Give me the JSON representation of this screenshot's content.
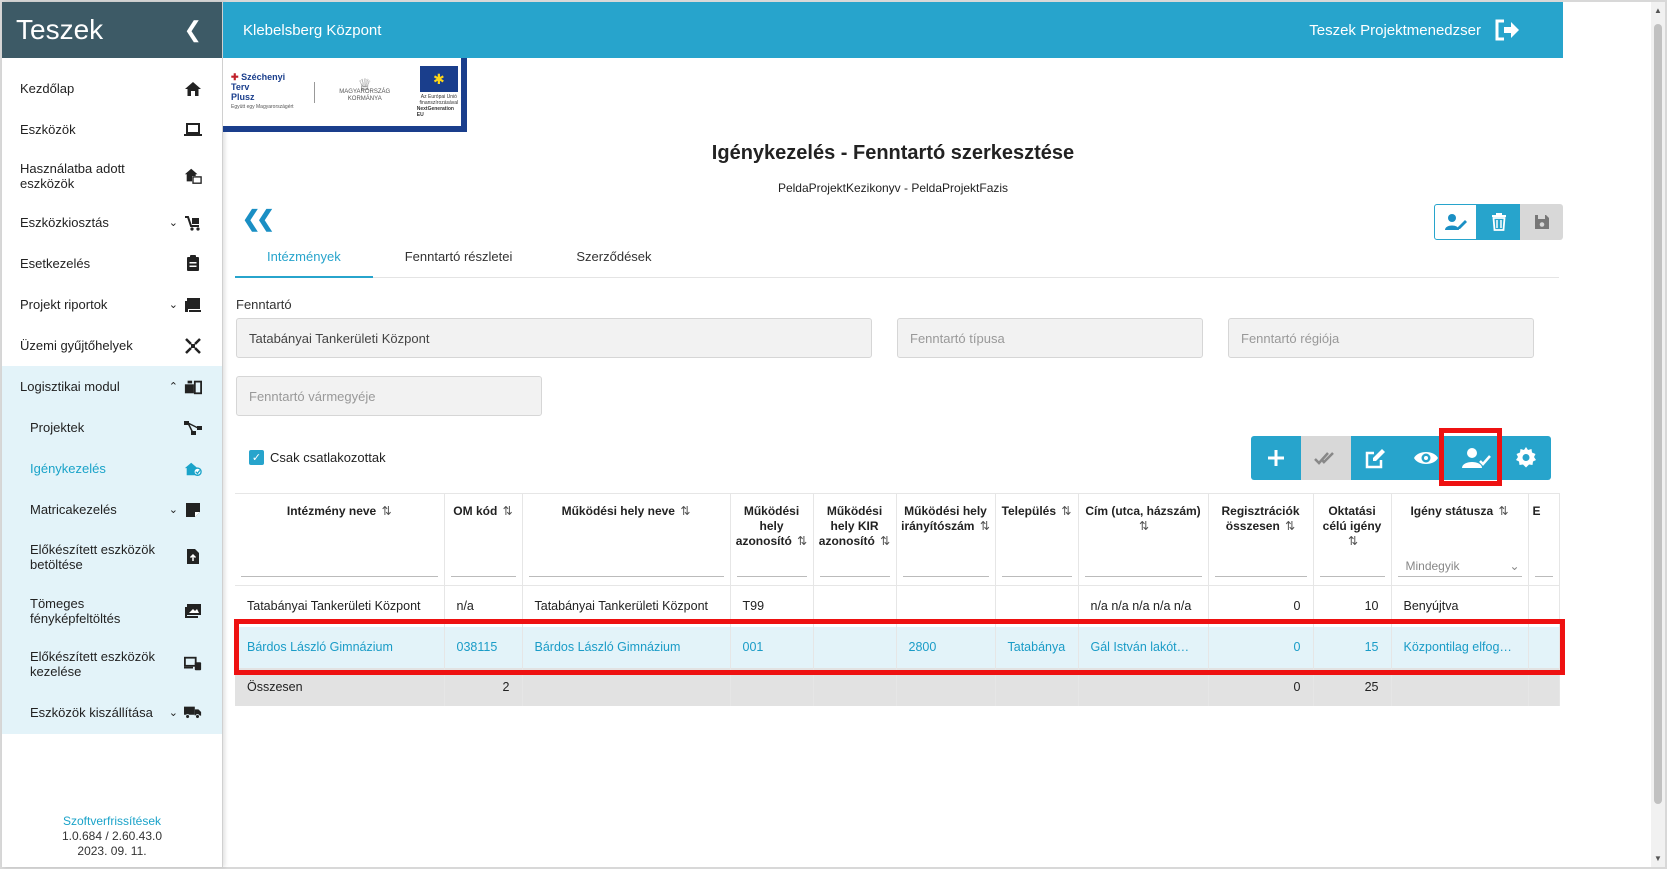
{
  "sidebar": {
    "title": "Teszek",
    "items": [
      {
        "label": "Kezdőlap"
      },
      {
        "label": "Eszközök"
      },
      {
        "label": "Használatba adott eszközök"
      },
      {
        "label": "Eszközkiosztás"
      },
      {
        "label": "Esetkezelés"
      },
      {
        "label": "Projekt riportok"
      },
      {
        "label": "Üzemi gyűjtőhelyek"
      },
      {
        "label": "Logisztikai modul"
      }
    ],
    "subitems": [
      {
        "label": "Projektek"
      },
      {
        "label": "Igénykezelés"
      },
      {
        "label": "Matricakezelés"
      },
      {
        "label": "Előkészített eszközök betöltése"
      },
      {
        "label": "Tömeges fényképfeltöltés"
      },
      {
        "label": "Előkészített eszközök kezelése"
      },
      {
        "label": "Eszközök kiszállítása"
      }
    ],
    "footer": {
      "updates_link": "Szoftverfrissítések",
      "version": "1.0.684 / 2.60.43.0",
      "date": "2023. 09. 11."
    }
  },
  "topbar": {
    "org": "Klebelsberg Központ",
    "user": "Teszek Projektmenedzser"
  },
  "banner": {
    "szechenyi_line1": "Széchenyi Terv",
    "szechenyi_line2": "Plusz",
    "szechenyi_small": "Együtt egy Magyarországért",
    "gov_text": "MAGYARORSZÁG KORMÁNYA",
    "eu_text1": "Az Európai Unió",
    "eu_text2": "finanszírozásával",
    "eu_text3": "NextGeneration EU"
  },
  "page": {
    "title": "Igénykezelés - Fenntartó szerkesztése",
    "subtitle": "PeldaProjektKezikonyv - PeldaProjektFazis"
  },
  "tabs": [
    {
      "label": "Intézmények",
      "active": true
    },
    {
      "label": "Fenntartó részletei",
      "active": false
    },
    {
      "label": "Szerződések",
      "active": false
    }
  ],
  "form": {
    "fenntarto_label": "Fenntartó",
    "fenntarto_value": "Tatabányai Tankerületi Központ",
    "tipus_placeholder": "Fenntartó típusa",
    "regio_placeholder": "Fenntartó régiója",
    "varmegye_placeholder": "Fenntartó vármegyéje",
    "checkbox_label": "Csak csatlakozottak"
  },
  "table": {
    "headers": [
      "Intézmény neve",
      "OM kód",
      "Működési hely neve",
      "Működési hely azonosító",
      "Működési hely KIR azonosító",
      "Működési hely irányítószám",
      "Település",
      "Cím (utca, házszám)",
      "Regisztrációk összesen",
      "Oktatási célú igény",
      "Igény státusza",
      "E"
    ],
    "status_filter": "Mindegyik",
    "rows": [
      [
        "Tatabányai Tankerületi Központ",
        "n/a",
        "Tatabányai Tankerületi Központ",
        "T99",
        "",
        "",
        "",
        "n/a n/a n/a n/a n/a",
        "0",
        "10",
        "Benyújtva"
      ],
      [
        "Bárdos László Gimnázium",
        "038115",
        "Bárdos László Gimnázium",
        "001",
        "",
        "2800",
        "Tatabánya",
        "Gál István lakótel…",
        "0",
        "15",
        "Központilag elfog…"
      ]
    ],
    "total": [
      "Összesen",
      "2",
      "",
      "",
      "",
      "",
      "",
      "",
      "0",
      "25",
      ""
    ]
  },
  "colors": {
    "accent": "#27a4cc",
    "sidebar_header": "#3d5a66",
    "highlight": "#ee1111",
    "selected_row": "#e3f3f9"
  }
}
